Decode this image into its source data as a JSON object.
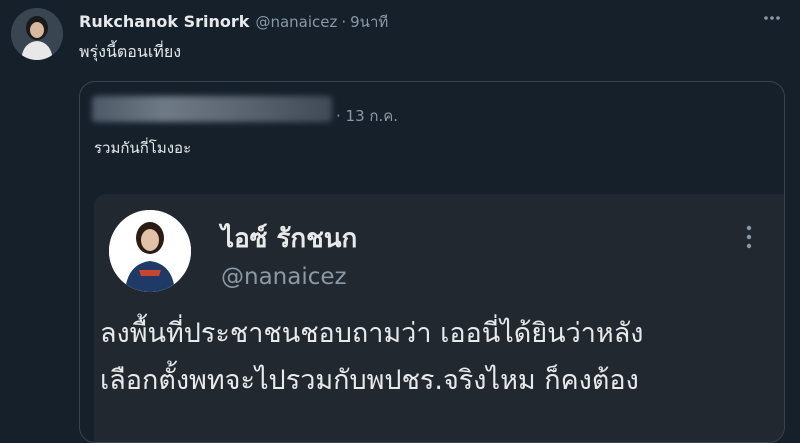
{
  "tweet": {
    "author_name": "Rukchanok Srinork",
    "handle": "@nanaicez",
    "separator": "·",
    "time": "9นาที",
    "text": "พรุ่งนี้ตอนเที่ยง",
    "more_icon": "more-horizontal-icon"
  },
  "quote": {
    "date": "· 13 ก.ค.",
    "text": "รวมกันกี่โมงอะ",
    "screenshot": {
      "name": "ไอซ์ รักชนก",
      "handle": "@nanaicez",
      "more_icon": "more-vertical-icon",
      "body_lines": [
        "ลงพื้นที่ประชาชนชอบถามว่า เออนี่ได้ยินว่าหลัง",
        "เลือกตั้งพทจะไปรวมกับพปชร.จริงไหม ก็คงต้อง"
      ]
    }
  },
  "colors": {
    "background": "#15202b",
    "text_primary": "#e7e9ea",
    "text_secondary": "#8b98a5",
    "border": "#38444d",
    "screenshot_bg": "#22282f"
  }
}
